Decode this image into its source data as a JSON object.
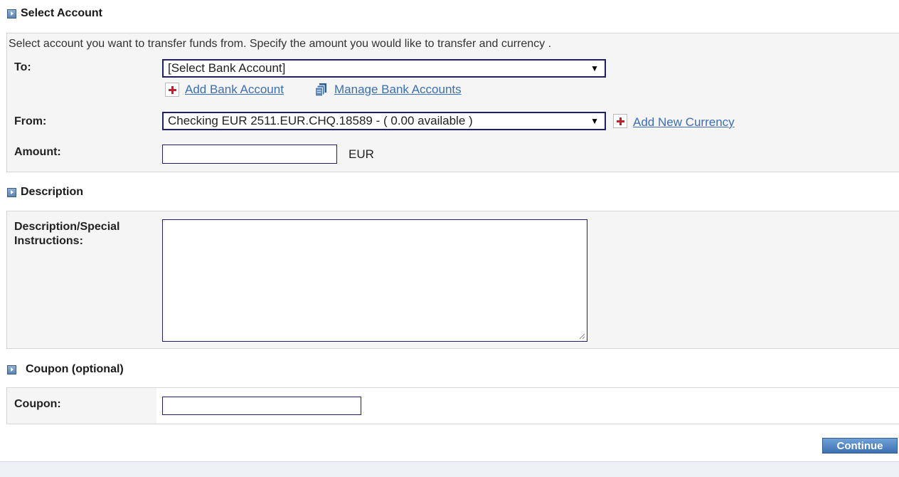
{
  "sections": {
    "select_account": "Select Account",
    "description": "Description",
    "coupon": "Coupon (optional)"
  },
  "account": {
    "instructions": "Select account you want to transfer funds from. Specify the amount you would like to transfer and currency .",
    "to_label": "To:",
    "to_value": "[Select Bank Account]",
    "add_bank_account": "Add Bank Account",
    "manage_bank_accounts": "Manage Bank Accounts",
    "from_label": "From:",
    "from_value": "Checking EUR 2511.EUR.CHQ.18589 - ( 0.00 available )",
    "add_new_currency": "Add New Currency",
    "amount_label": "Amount:",
    "amount_value": "",
    "currency": "EUR"
  },
  "description": {
    "label": "Description/Special Instructions:",
    "value": ""
  },
  "coupon": {
    "label": "Coupon:",
    "value": ""
  },
  "actions": {
    "continue": "Continue"
  },
  "icons": {
    "section": "section-arrow-icon",
    "add": "plus-icon",
    "manage": "documents-icon",
    "dropdown": "chevron-down-icon"
  },
  "colors": {
    "link": "#3b6fb5",
    "input_border": "#1f1f6e",
    "button": "#3e72b3",
    "add_icon": "#c41f2a"
  }
}
